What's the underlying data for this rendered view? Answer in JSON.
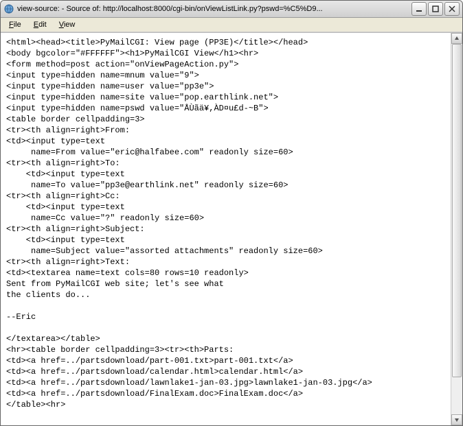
{
  "titlebar": {
    "title": "view-source: - Source of: http://localhost:8000/cgi-bin/onViewListLink.py?pswd=%C5%D9..."
  },
  "menubar": {
    "file": "File",
    "edit": "Edit",
    "view": "View"
  },
  "source_lines": [
    "<html><head><title>PyMailCGI: View page (PP3E)</title></head>",
    "<body bgcolor=\"#FFFFFF\"><h1>PyMailCGI View</h1><hr>",
    "<form method=post action=\"onViewPageAction.py\">",
    "<input type=hidden name=mnum value=\"9\">",
    "<input type=hidden name=user value=\"pp3e\">",
    "<input type=hidden name=site value=\"pop.earthlink.net\">",
    "<input type=hidden name=pswd value=\"ÅÙãä¥,ÀD¤u£d-~B\">",
    "<table border cellpadding=3>",
    "<tr><th align=right>From:",
    "<td><input type=text",
    "     name=From value=\"eric@halfabee.com\" readonly size=60>",
    "<tr><th align=right>To:",
    "    <td><input type=text",
    "     name=To value=\"pp3e@earthlink.net\" readonly size=60>",
    "<tr><th align=right>Cc:",
    "    <td><input type=text",
    "     name=Cc value=\"?\" readonly size=60>",
    "<tr><th align=right>Subject:",
    "    <td><input type=text",
    "     name=Subject value=\"assorted attachments\" readonly size=60>",
    "<tr><th align=right>Text:",
    "<td><textarea name=text cols=80 rows=10 readonly>",
    "Sent from PyMailCGI web site; let's see what",
    "the clients do...",
    "",
    "--Eric",
    "",
    "</textarea></table>",
    "<hr><table border cellpadding=3><tr><th>Parts:",
    "<td><a href=../partsdownload/part-001.txt>part-001.txt</a>",
    "<td><a href=../partsdownload/calendar.html>calendar.html</a>",
    "<td><a href=../partsdownload/lawnlake1-jan-03.jpg>lawnlake1-jan-03.jpg</a>",
    "<td><a href=../partsdownload/FinalExam.doc>FinalExam.doc</a>",
    "</table><hr>"
  ]
}
